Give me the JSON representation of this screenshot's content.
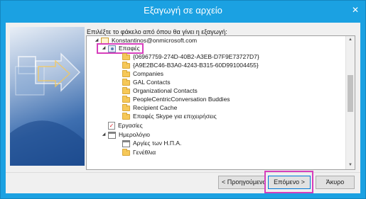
{
  "window": {
    "title": "Εξαγωγή σε αρχείο",
    "close_glyph": "✕"
  },
  "instruction": "Επιλέξτε το φάκελο από όπου θα γίνει η εξαγωγή:",
  "tree": [
    {
      "label": "Konstantinos@onmicrosoft.com",
      "icon": "mailbox-icon",
      "expander": "◢"
    },
    {
      "label": "Επαφές",
      "icon": "contacts-icon",
      "expander": "◢",
      "highlighted": true
    },
    {
      "label": "{06967759-274D-40B2-A3EB-D7F9E73727D7}",
      "icon": "folder-icon"
    },
    {
      "label": "{A9E2BC46-B3A0-4243-B315-60D991004455}",
      "icon": "folder-icon"
    },
    {
      "label": "Companies",
      "icon": "folder-icon"
    },
    {
      "label": "GAL Contacts",
      "icon": "folder-icon"
    },
    {
      "label": "Organizational Contacts",
      "icon": "folder-icon"
    },
    {
      "label": "PeopleCentricConversation Buddies",
      "icon": "folder-icon"
    },
    {
      "label": "Recipient Cache",
      "icon": "folder-icon"
    },
    {
      "label": "Επαφές Skype για επιχειρήσεις",
      "icon": "folder-icon"
    },
    {
      "label": "Εργασίες",
      "icon": "tasks-icon"
    },
    {
      "label": "Ημερολόγιο",
      "icon": "calendar-icon",
      "expander": "◢"
    },
    {
      "label": "Αργίες των Η.Π.Α.",
      "icon": "calendar-icon"
    },
    {
      "label": "Γενέθλια",
      "icon": "folder-icon"
    }
  ],
  "scrollbar": {
    "up": "▲",
    "down": "▼"
  },
  "buttons": {
    "back": "< Προηγούμενο",
    "next": "Επόμενο >",
    "cancel": "Άκυρο"
  },
  "colors": {
    "title_bar": "#1ba1e2",
    "highlight": "#d63fbc",
    "folder": "#f6c858"
  }
}
